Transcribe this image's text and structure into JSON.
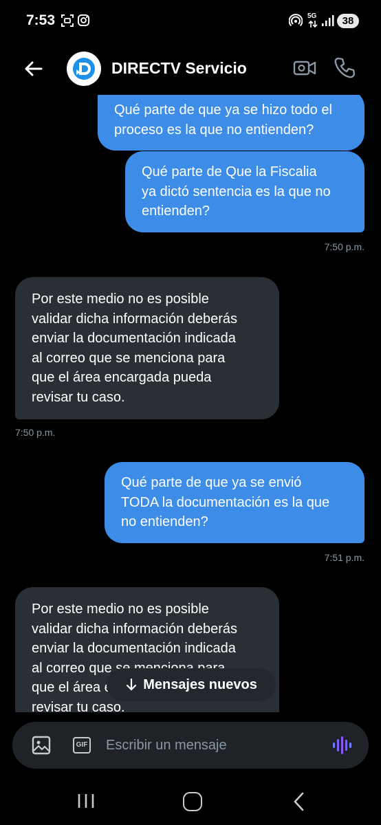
{
  "status": {
    "time": "7:53",
    "battery": "38",
    "network": "5G"
  },
  "header": {
    "title": "DIRECTV Servicio"
  },
  "messages": [
    {
      "type": "sent",
      "text": "Qué parte de que ya se hizo todo el\nproceso es la que no entienden?"
    },
    {
      "type": "sent",
      "text": "Qué parte de Que la Fiscalia\nya dictó sentencia es la que no\nentienden?",
      "time": "7:50 p.m."
    },
    {
      "type": "received",
      "text": "Por este medio no es posible\nvalidar dicha información deberás\nenviar la documentación indicada\nal correo que se menciona para\nque el área encargada pueda\nrevisar tu caso.",
      "time": "7:50 p.m."
    },
    {
      "type": "sent",
      "text": "Qué parte de que ya se envió\nTODA la documentación es la que\nno entienden?",
      "time": "7:51 p.m."
    },
    {
      "type": "received",
      "text": "Por este medio no es posible\nvalidar dicha información deberás\nenviar la documentación indicada\nal correo que se menciona para\nque el área encargada pueda\nrevisar tu caso."
    }
  ],
  "new_messages_label": "Mensajes nuevos",
  "composer": {
    "placeholder": "Escribir un mensaje",
    "gif_label": "GIF"
  },
  "colors": {
    "sent_bubble": "#3d8de8",
    "received_bubble": "#2a2f35",
    "voice_accent": "#7b61ff"
  }
}
